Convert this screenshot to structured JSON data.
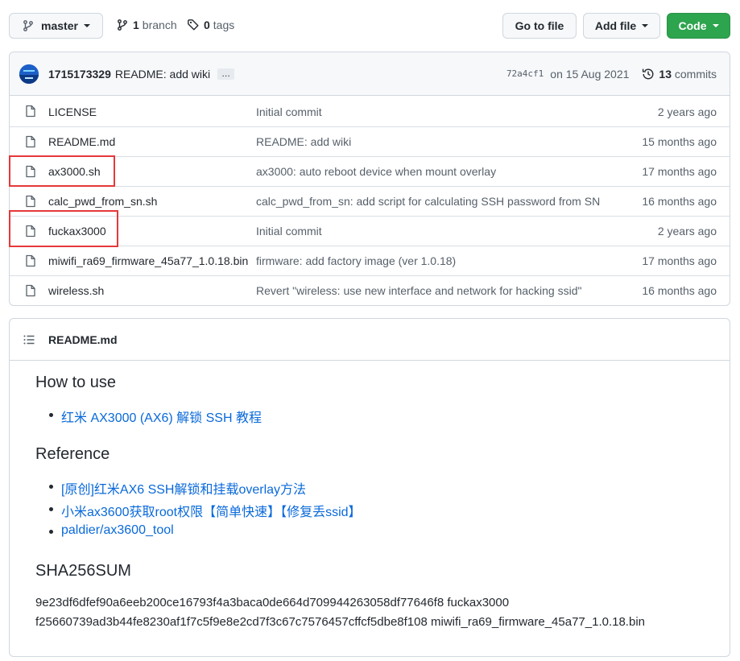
{
  "toolbar": {
    "branch_name": "master",
    "branch_count": "1",
    "branch_label": "branch",
    "tag_count": "0",
    "tag_label": "tags",
    "goto_file": "Go to file",
    "add_file": "Add file",
    "code": "Code"
  },
  "commit": {
    "author": "1715173329",
    "message": "README: add wiki",
    "ellipsis": "…",
    "sha": "72a4cf1",
    "date": "on 15 Aug 2021",
    "count": "13",
    "count_label": "commits"
  },
  "files": [
    {
      "name": "LICENSE",
      "message": "Initial commit",
      "time": "2 years ago"
    },
    {
      "name": "README.md",
      "message": "README: add wiki",
      "time": "15 months ago"
    },
    {
      "name": "ax3000.sh",
      "message": "ax3000: auto reboot device when mount overlay",
      "time": "17 months ago"
    },
    {
      "name": "calc_pwd_from_sn.sh",
      "message": "calc_pwd_from_sn: add script for calculating SSH password from SN",
      "time": "16 months ago"
    },
    {
      "name": "fuckax3000",
      "message": "Initial commit",
      "time": "2 years ago"
    },
    {
      "name": "miwifi_ra69_firmware_45a77_1.0.18.bin",
      "message": "firmware: add factory image (ver 1.0.18)",
      "time": "17 months ago"
    },
    {
      "name": "wireless.sh",
      "message": "Revert \"wireless: use new interface and network for hacking ssid\"",
      "time": "16 months ago"
    }
  ],
  "readme": {
    "title": "README.md",
    "how_to_use": {
      "heading": "How to use",
      "items": [
        "红米 AX3000 (AX6) 解锁 SSH 教程"
      ]
    },
    "reference": {
      "heading": "Reference",
      "items": [
        "[原创]红米AX6 SSH解锁和挂载overlay方法",
        "小米ax3600获取root权限【简单快速】【修复丢ssid】",
        "paldier/ax3600_tool"
      ]
    },
    "sha256": {
      "heading": "SHA256SUM",
      "lines": [
        "9e23df6dfef90a6eeb200ce16793f4a3baca0de664d709944263058df77646f8 fuckax3000",
        "f25660739ad3b44fe8230af1f7c5f9e8e2cd7f3c67c7576457cffcf5dbe8f108 miwifi_ra69_firmware_45a77_1.0.18.bin"
      ]
    }
  },
  "colors": {
    "link": "#0969da",
    "green_button": "#2da44e",
    "highlight_box": "#e5383b"
  }
}
